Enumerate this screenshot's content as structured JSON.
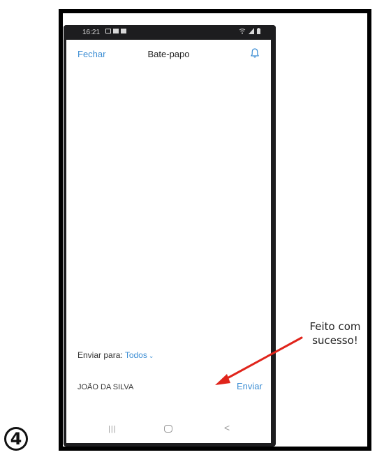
{
  "step": {
    "number": "4"
  },
  "status_bar": {
    "time": "16:21"
  },
  "header": {
    "close_label": "Fechar",
    "title": "Bate-papo",
    "bell_icon": "bell-icon"
  },
  "composer": {
    "send_to_label": "Enviar para:",
    "send_to_value": "Todos",
    "sender_name": "JOÃO DA SILVA",
    "send_label": "Enviar"
  },
  "nav_bar": {
    "recents_glyph": "|||",
    "back_glyph": "<"
  },
  "annotation": {
    "line1": "Feito com",
    "line2": "sucesso!",
    "arrow_color": "#e0241b"
  },
  "colors": {
    "accent": "#3d8ed4"
  }
}
